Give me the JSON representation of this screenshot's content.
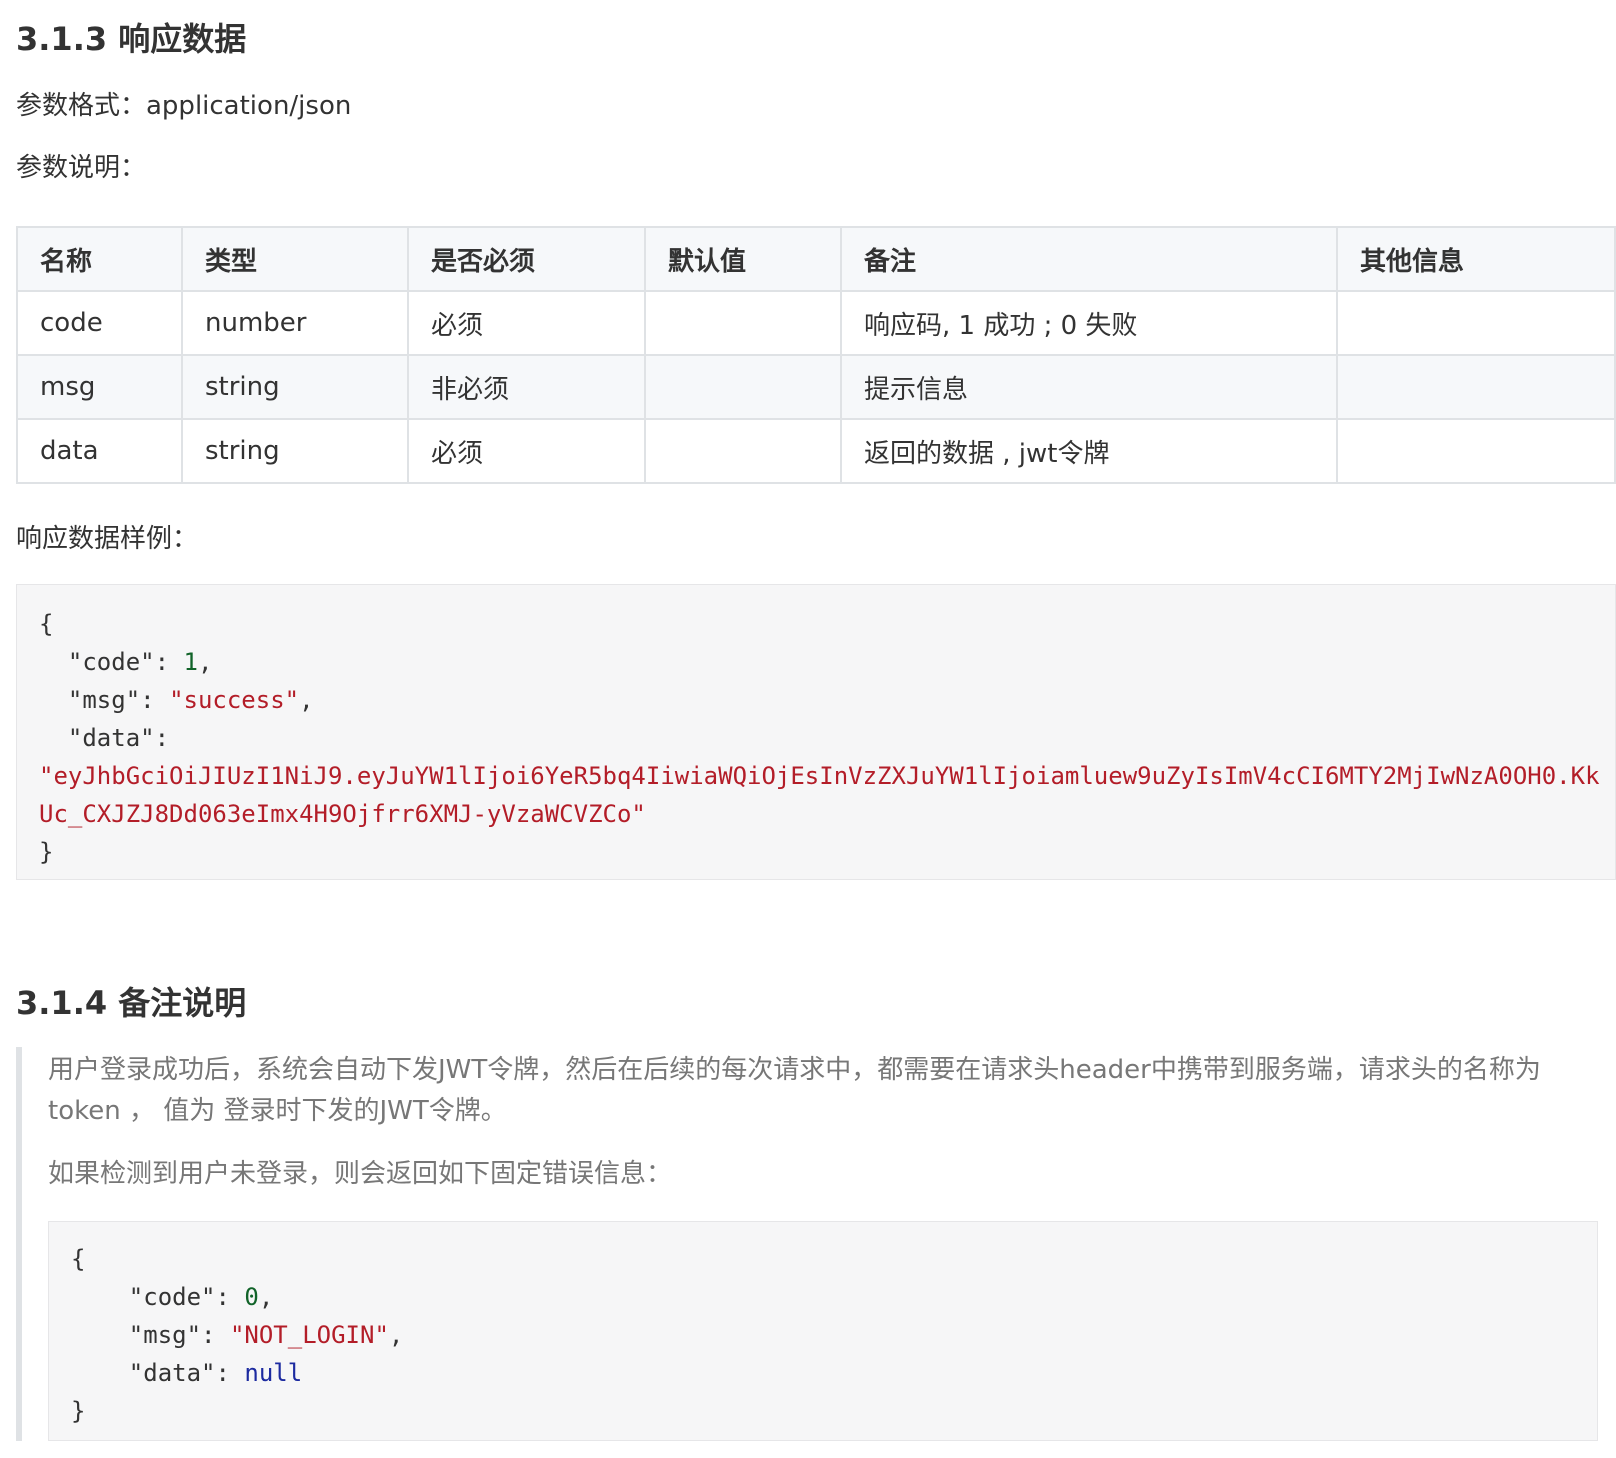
{
  "section1": {
    "title": "3.1.3 响应数据",
    "param_format": "参数格式：application/json",
    "param_desc": "参数说明：",
    "table": {
      "headers": [
        "名称",
        "类型",
        "是否必须",
        "默认值",
        "备注",
        "其他信息"
      ],
      "rows": [
        [
          "code",
          "number",
          "必须",
          "",
          "响应码, 1 成功 ; 0  失败",
          ""
        ],
        [
          "msg",
          "string",
          "非必须",
          "",
          "提示信息",
          ""
        ],
        [
          "data",
          "string",
          "必须",
          "",
          "返回的数据 , jwt令牌",
          ""
        ]
      ]
    },
    "sample_label": "响应数据样例：",
    "sample_code": {
      "open": "{",
      "code_key": "\"code\"",
      "code_val": "1",
      "msg_key": "\"msg\"",
      "msg_val": "\"success\"",
      "data_key": "\"data\"",
      "data_val_line1": "\"eyJhbGciOiJIUzI1NiJ9.eyJuYW1lIjoi6YeR5bq4IiwiaWQiOjEsInVzZXJuYW1lIjoiamluew9uZyIsImV4cCI6MTY2MjIwNzA0OH0.Kk",
      "data_val_line2": "Uc_CXJZJ8Dd063eImx4H9Ojfrr6XMJ-yVzaWCVZCo\"",
      "close": "}"
    }
  },
  "section2": {
    "title": "3.1.4 备注说明",
    "note_line1": "用户登录成功后，系统会自动下发JWT令牌，然后在后续的每次请求中，都需要在请求头header中携带到服务端，请求头的名称为",
    "note_line2": "token ， 值为 登录时下发的JWT令牌。",
    "note_line3": "如果检测到用户未登录，则会返回如下固定错误信息：",
    "error_code": {
      "open": "{",
      "code_key": "\"code\"",
      "code_val": "0",
      "msg_key": "\"msg\"",
      "msg_val": "\"NOT_LOGIN\"",
      "data_key": "\"data\"",
      "data_val": "null",
      "close": "}"
    }
  },
  "colors": {
    "string": "#b31d28",
    "number": "#116329",
    "keyword": "#1c2aa0",
    "border": "#dfe2e5"
  }
}
